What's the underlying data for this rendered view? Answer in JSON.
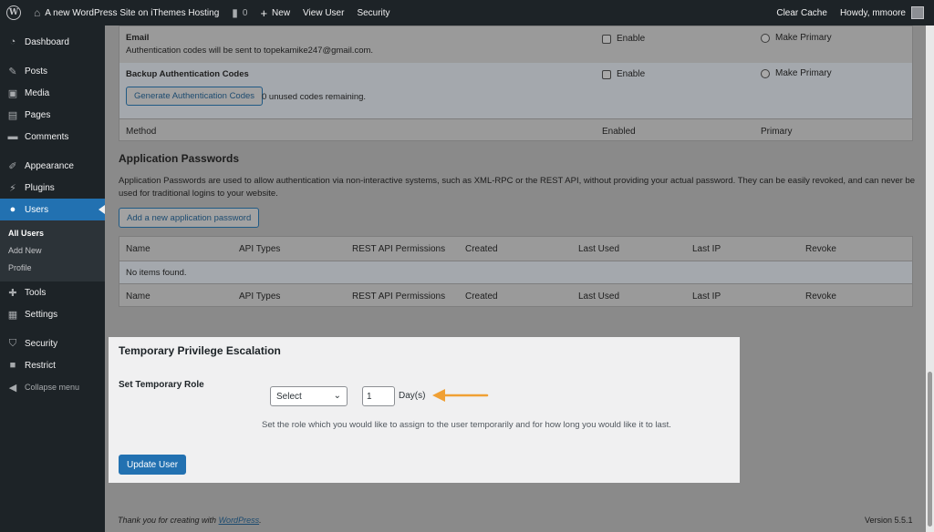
{
  "admin_bar": {
    "site_name": "A new WordPress Site on iThemes Hosting",
    "comments_count": "0",
    "new_label": "New",
    "view_user": "View User",
    "security": "Security",
    "clear_cache": "Clear Cache",
    "howdy": "Howdy, mmoore"
  },
  "sidebar": {
    "items": [
      {
        "label": "Dashboard",
        "icon": "dashboard-icon"
      },
      {
        "label": "Posts",
        "icon": "pin-icon"
      },
      {
        "label": "Media",
        "icon": "media-icon"
      },
      {
        "label": "Pages",
        "icon": "pages-icon"
      },
      {
        "label": "Comments",
        "icon": "comment-icon"
      },
      {
        "label": "Appearance",
        "icon": "brush-icon"
      },
      {
        "label": "Plugins",
        "icon": "plug-icon"
      },
      {
        "label": "Users",
        "icon": "user-icon"
      },
      {
        "label": "Tools",
        "icon": "wrench-icon"
      },
      {
        "label": "Settings",
        "icon": "settings-icon"
      },
      {
        "label": "Security",
        "icon": "shield-icon"
      },
      {
        "label": "Restrict",
        "icon": "lock-icon"
      }
    ],
    "users_submenu": [
      "All Users",
      "Add New",
      "Profile"
    ],
    "collapse": "Collapse menu"
  },
  "two_factor": {
    "email": {
      "title": "Email",
      "description": "Authentication codes will be sent to topekamike247@gmail.com.",
      "enable": "Enable",
      "make_primary": "Make Primary"
    },
    "backup": {
      "title": "Backup Authentication Codes",
      "button": "Generate Authentication Codes",
      "remaining": "0 unused codes remaining.",
      "enable": "Enable",
      "make_primary": "Make Primary"
    },
    "footer": {
      "method": "Method",
      "enabled": "Enabled",
      "primary": "Primary"
    }
  },
  "app_passwords": {
    "title": "Application Passwords",
    "description_line1": "Application Passwords are used to allow authentication via non-interactive systems, such as XML-RPC or the REST API, without providing your actual password. They can be easily revoked, and can never be",
    "description_line2": "used for traditional logins to your website.",
    "add_button": "Add a new application password",
    "columns": [
      "Name",
      "API Types",
      "REST API Permissions",
      "Created",
      "Last Used",
      "Last IP",
      "Revoke"
    ],
    "empty": "No items found."
  },
  "privilege": {
    "title": "Temporary Privilege Escalation",
    "label": "Set Temporary Role",
    "select_value": "Select",
    "days_value": "1",
    "days_label": "Day(s)",
    "description": "Set the role which you would like to assign to the user temporarily and for how long you would like it to last.",
    "update_button": "Update User",
    "arrow_color": "#f0a034"
  },
  "footer": {
    "thanks_prefix": "Thank you for creating with ",
    "wordpress_link": "WordPress",
    "thanks_suffix": ".",
    "version": "Version 5.5.1"
  }
}
